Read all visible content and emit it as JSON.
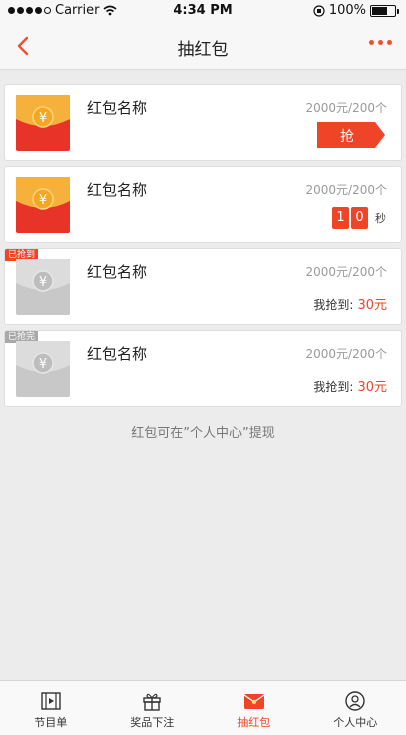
{
  "status_bar": {
    "carrier": "Carrier",
    "time": "4:34 PM",
    "battery": "100%"
  },
  "nav": {
    "title": "抽红包"
  },
  "cards": [
    {
      "name": "红包名称",
      "amount": "2000元/200个",
      "action": "抢"
    },
    {
      "name": "红包名称",
      "amount": "2000元/200个",
      "countdown": [
        "1",
        "0"
      ],
      "unit": "秒"
    },
    {
      "name": "红包名称",
      "amount": "2000元/200个",
      "ribbon": "已抢到",
      "got_label": "我抢到:",
      "got_value": "30元"
    },
    {
      "name": "红包名称",
      "amount": "2000元/200个",
      "ribbon": "已抢完",
      "got_label": "我抢到:",
      "got_value": "30元"
    }
  ],
  "hint": "红包可在”个人中心”提现",
  "tabs": [
    {
      "label": "节目单",
      "icon": "film-icon"
    },
    {
      "label": "奖品下注",
      "icon": "gift-icon"
    },
    {
      "label": "抽红包",
      "icon": "red-envelope-icon",
      "active": true
    },
    {
      "label": "个人中心",
      "icon": "user-circle-icon"
    }
  ],
  "colors": {
    "accent": "#f04428",
    "envelope_red": "#e83428",
    "envelope_gray": "#c8c8c8"
  }
}
